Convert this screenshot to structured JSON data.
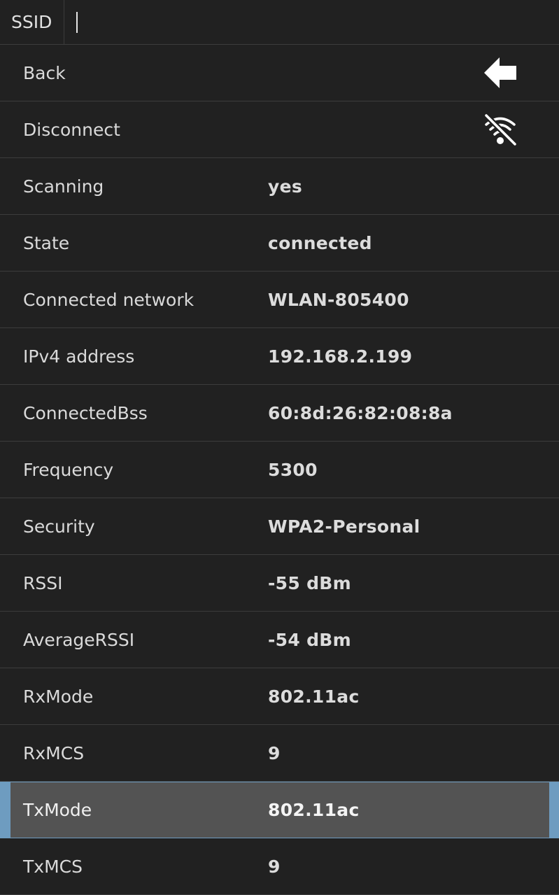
{
  "header": {
    "ssid_label": "SSID",
    "ssid_value": ""
  },
  "actions": {
    "back_label": "Back",
    "back_icon": "arrow-left-icon",
    "disconnect_label": "Disconnect",
    "disconnect_icon": "wifi-off-icon"
  },
  "details": [
    {
      "label": "Scanning",
      "value": "yes"
    },
    {
      "label": "State",
      "value": "connected"
    },
    {
      "label": "Connected network",
      "value": "WLAN-805400"
    },
    {
      "label": "IPv4 address",
      "value": "192.168.2.199"
    },
    {
      "label": "ConnectedBss",
      "value": "60:8d:26:82:08:8a"
    },
    {
      "label": "Frequency",
      "value": "5300"
    },
    {
      "label": "Security",
      "value": "WPA2-Personal"
    },
    {
      "label": "RSSI",
      "value": "-55 dBm"
    },
    {
      "label": "AverageRSSI",
      "value": "-54 dBm"
    },
    {
      "label": "RxMode",
      "value": "802.11ac"
    },
    {
      "label": "RxMCS",
      "value": "9"
    },
    {
      "label": "TxMode",
      "value": "802.11ac"
    },
    {
      "label": "TxMCS",
      "value": "9"
    }
  ],
  "colors": {
    "background": "#212121",
    "selected_background": "#535353",
    "selection_accent": "#6e9cc0",
    "text": "#dcdcdc"
  }
}
